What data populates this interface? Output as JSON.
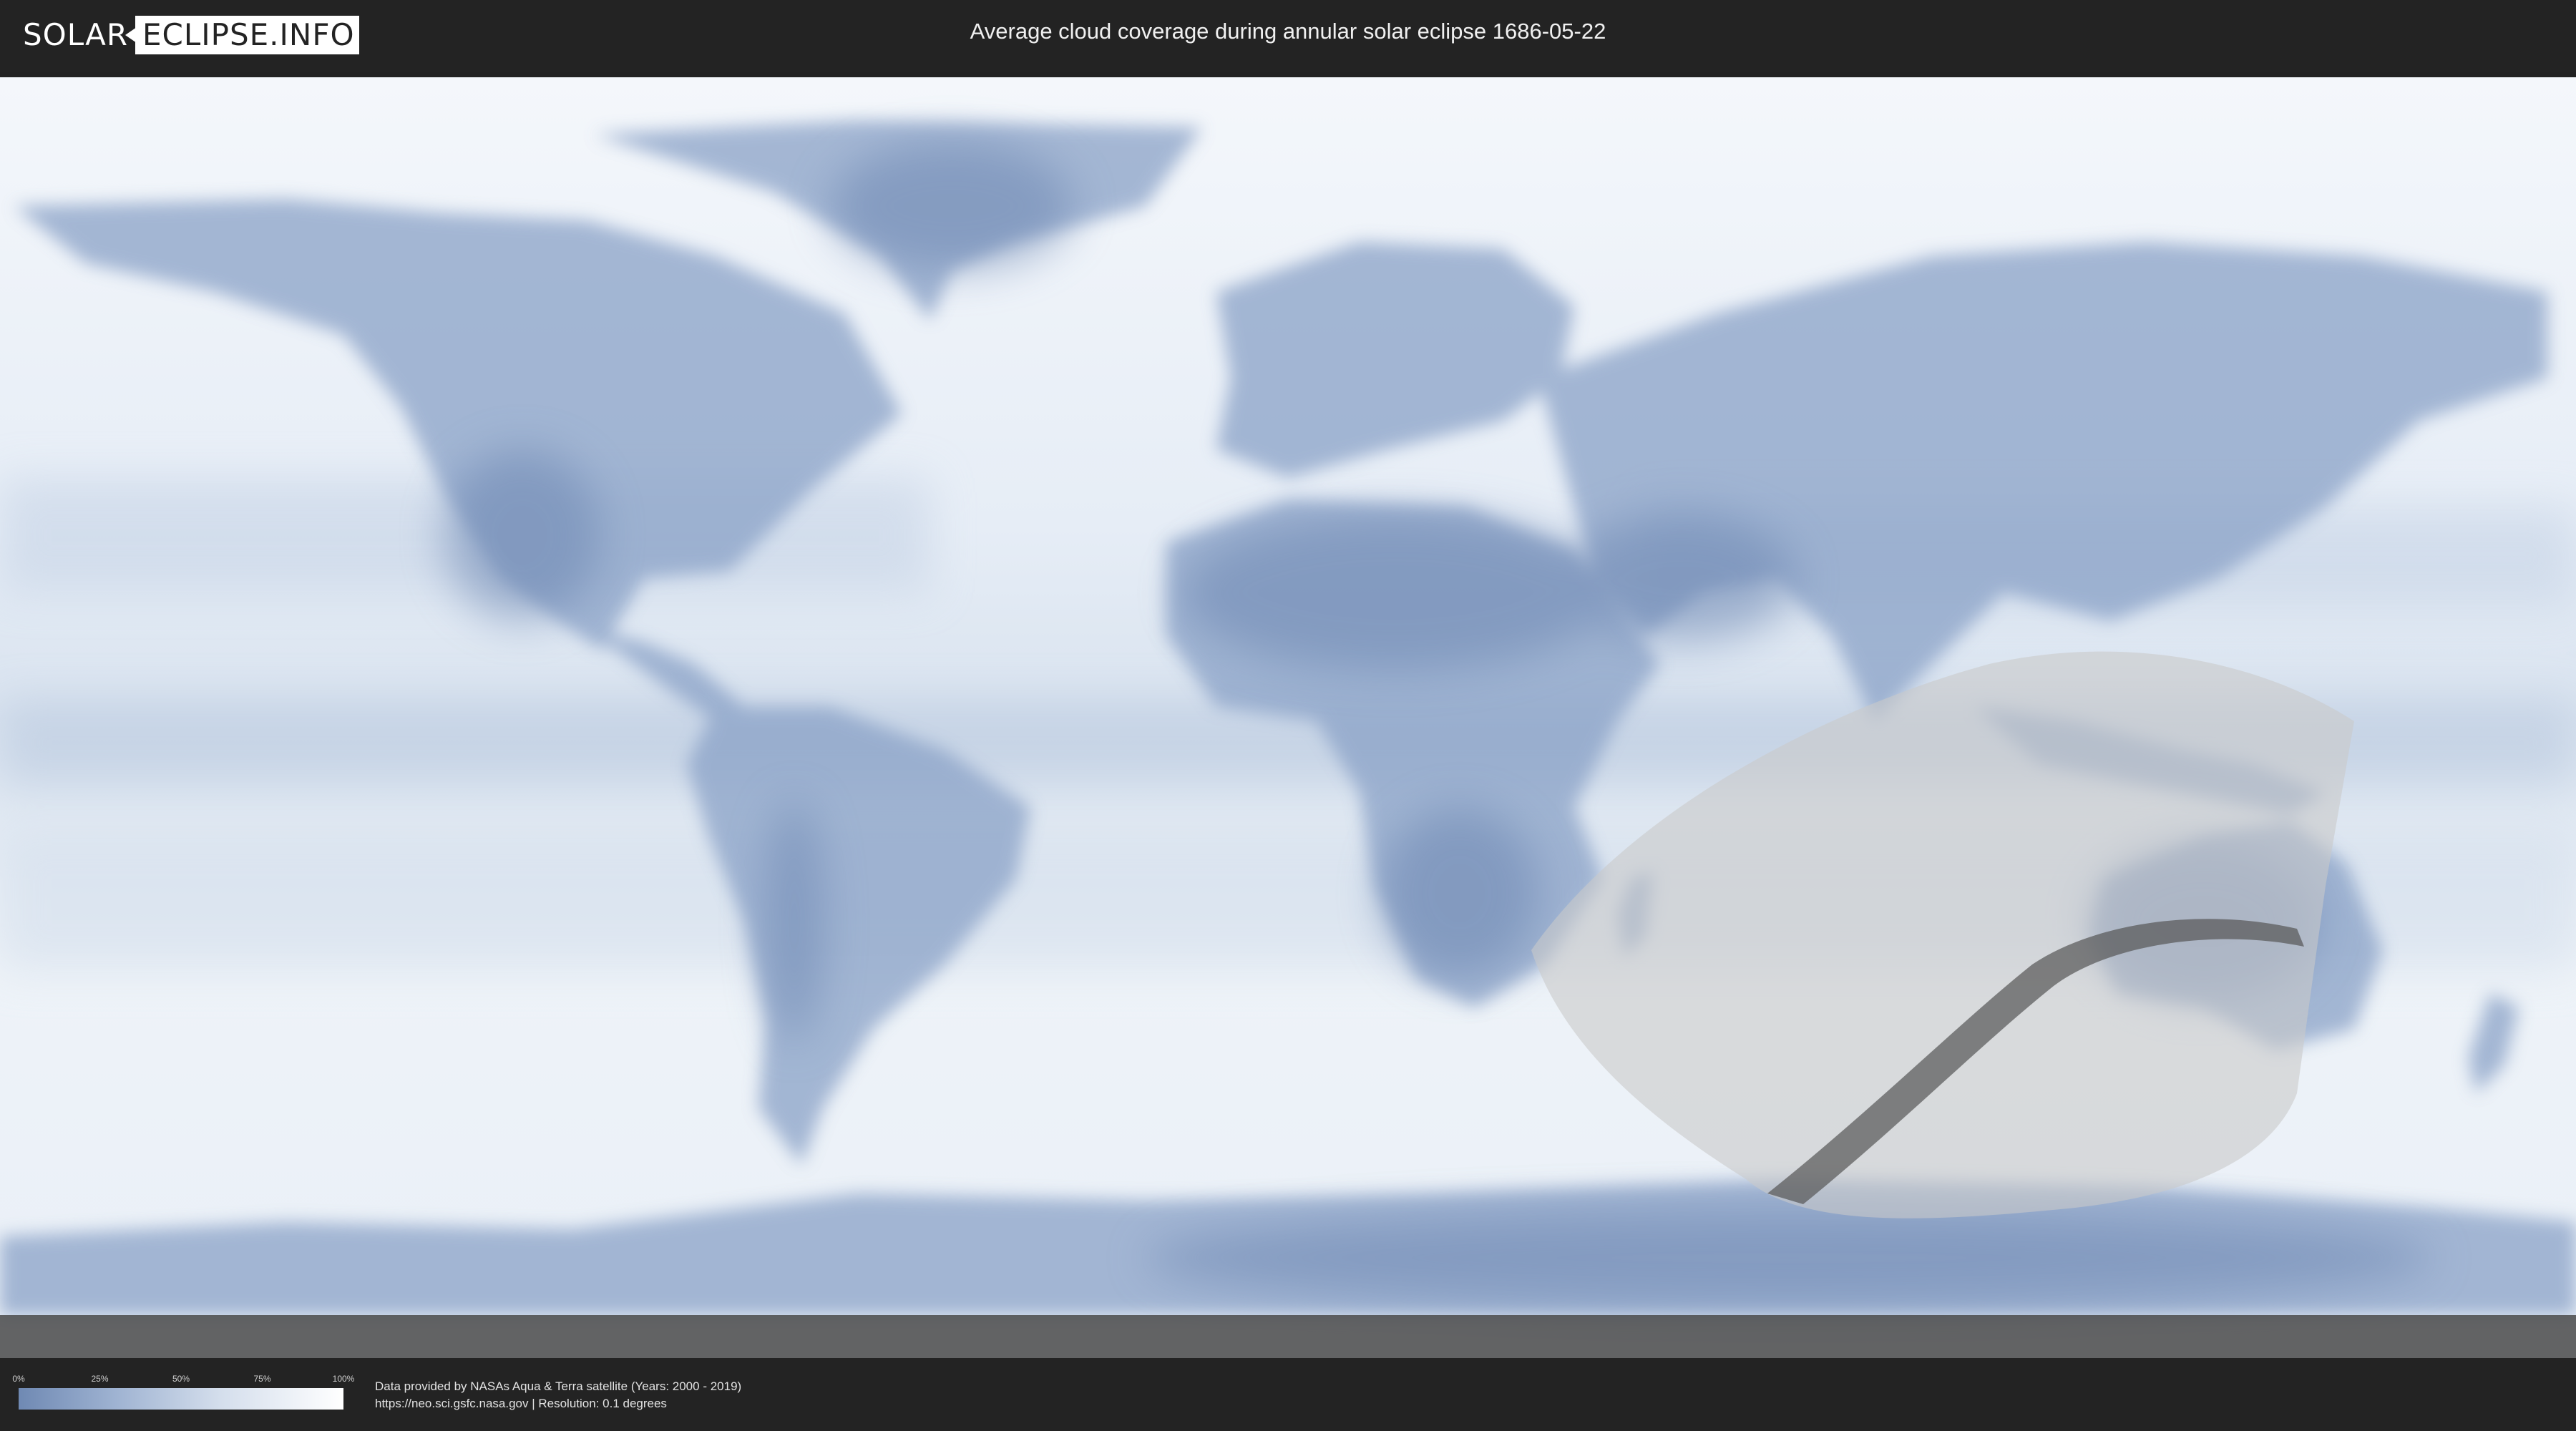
{
  "header": {
    "logo_left": "SOLAR",
    "logo_right": "ECLIPSE.INFO",
    "title": "Average cloud coverage during annular solar eclipse 1686-05-22"
  },
  "map": {
    "ocean_color": "#eef2f7",
    "land_color": "#7f99c1",
    "cloud_color": "#ffffff",
    "eclipse_zone_color": "#c9c9c9",
    "central_path_color": "#555555"
  },
  "legend": {
    "ticks": [
      "0%",
      "25%",
      "50%",
      "75%",
      "100%"
    ],
    "gradient_start": "#6f89b3",
    "gradient_end": "#ffffff"
  },
  "credits": {
    "line1": "Data provided by NASAs Aqua & Terra satellite (Years: 2000 - 2019)",
    "line2": "https://neo.sci.gsfc.nasa.gov | Resolution: 0.1 degrees"
  }
}
